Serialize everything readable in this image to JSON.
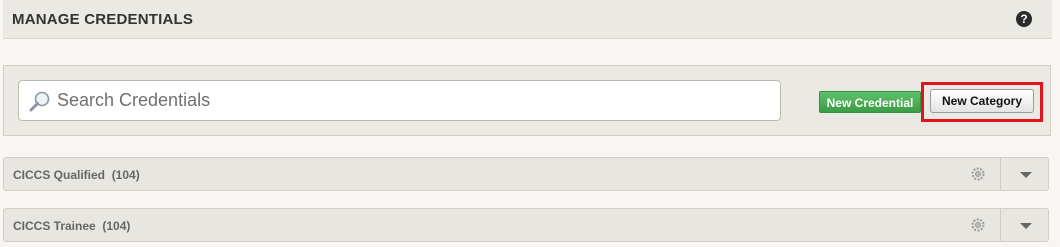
{
  "header": {
    "title": "MANAGE CREDENTIALS",
    "help_icon": "?"
  },
  "search": {
    "placeholder": "Search Credentials",
    "icon": "search-icon"
  },
  "actions": {
    "new_credential_label": "New Credential",
    "new_category_label": "New Category",
    "highlight_color": "#e0141c",
    "new_credential_color": "#4caf50"
  },
  "categories": [
    {
      "label": "CICCS Qualified",
      "count": "(104)"
    },
    {
      "label": "CICCS Trainee",
      "count": "(104)"
    }
  ]
}
